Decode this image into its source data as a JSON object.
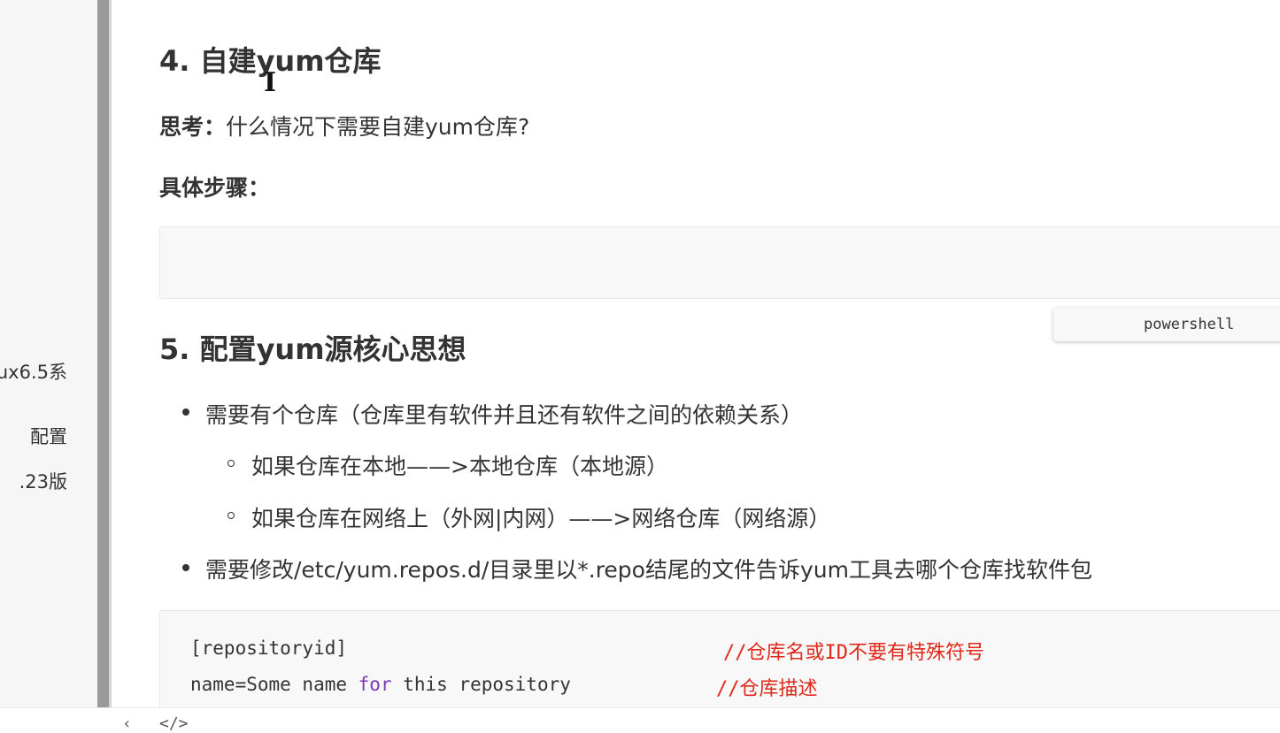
{
  "sidebar": {
    "items": [
      {
        "label": "ux6.5系"
      },
      {
        "label": "配置"
      },
      {
        "label": ".23版"
      }
    ]
  },
  "main": {
    "h4": "4. 自建yum仓库",
    "think_label": "思考：",
    "think_text": "什么情况下需要自建yum仓库?",
    "steps_label": "具体步骤：",
    "lang_badge": "powershell",
    "h5": "5. 配置yum源核心思想",
    "bullets": [
      "需要有个仓库（仓库里有软件并且还有软件之间的依赖关系）",
      "如果仓库在本地——>本地仓库（本地源）",
      "如果仓库在网络上（外网|内网）——>网络仓库（网络源）",
      "需要修改/etc/yum.repos.d/目录里以*.repo结尾的文件告诉yum工具去哪个仓库找软件包"
    ],
    "code": {
      "line1": "[repositoryid]",
      "line1_comment": "//仓库名或ID不要有特殊符号",
      "line2_pre": "name=Some name ",
      "line2_kw": "for",
      "line2_post": " this repository",
      "line2_comment": "//仓库描述"
    }
  },
  "bottom": {
    "icon_left": "‹",
    "icon_code": "</>"
  }
}
